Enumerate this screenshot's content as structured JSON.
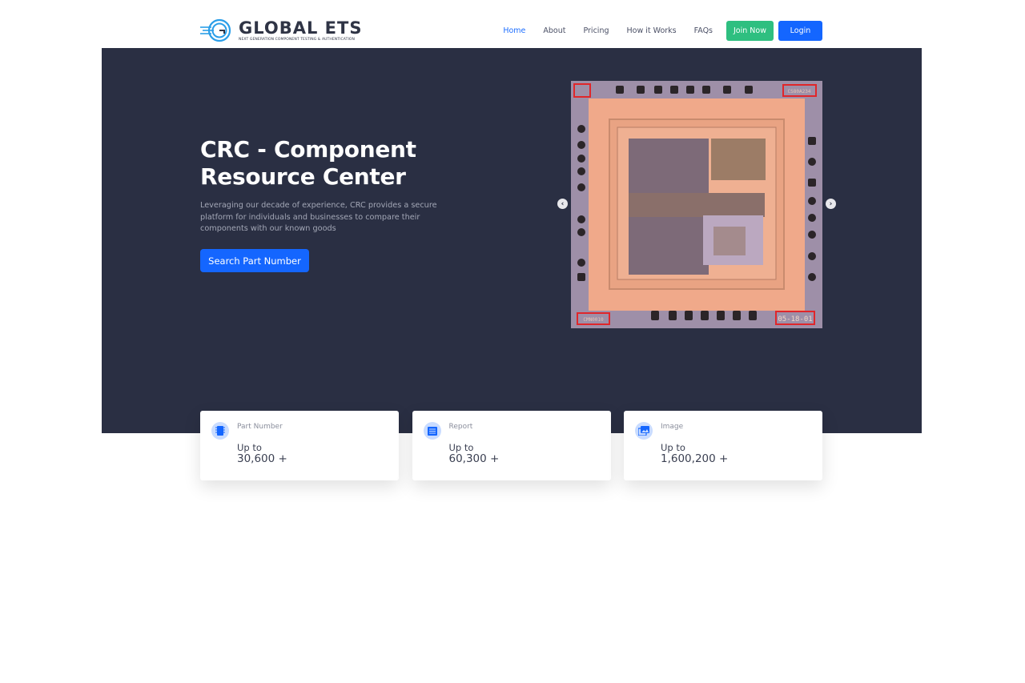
{
  "header": {
    "logo_title": "GLOBAL ETS",
    "logo_subtitle": "NEXT GENERATION COMPONENT TESTING & AUTHENTICATION",
    "nav": [
      {
        "label": "Home",
        "active": true
      },
      {
        "label": "About",
        "active": false
      },
      {
        "label": "Pricing",
        "active": false
      },
      {
        "label": "How it Works",
        "active": false
      },
      {
        "label": "FAQs",
        "active": false
      }
    ],
    "join_label": "Join Now",
    "login_label": "Login"
  },
  "hero": {
    "title": "CRC - Component Resource Center",
    "description": "Leveraging our decade of experience, CRC provides a secure platform for individuals and businesses to compare their components with our known goods",
    "cta_label": "Search Part Number",
    "carousel": {
      "image_alt": "Integrated circuit die microscope image",
      "labels": {
        "top_right": "CS80A234",
        "bottom_left": "CMN0010",
        "bottom_right": "05-18-01"
      },
      "prev_icon": "chevron-left-icon",
      "next_icon": "chevron-right-icon"
    }
  },
  "stats": [
    {
      "label": "Part Number",
      "upto": "Up to",
      "value": "30,600 +",
      "icon": "chip-icon"
    },
    {
      "label": "Report",
      "upto": "Up to",
      "value": "60,300 +",
      "icon": "list-icon"
    },
    {
      "label": "Image",
      "upto": "Up to",
      "value": "1,600,200 +",
      "icon": "images-icon"
    }
  ],
  "colors": {
    "brand_blue": "#1466ff",
    "join_green": "#2ebf80",
    "hero_bg": "#2a2f43"
  }
}
